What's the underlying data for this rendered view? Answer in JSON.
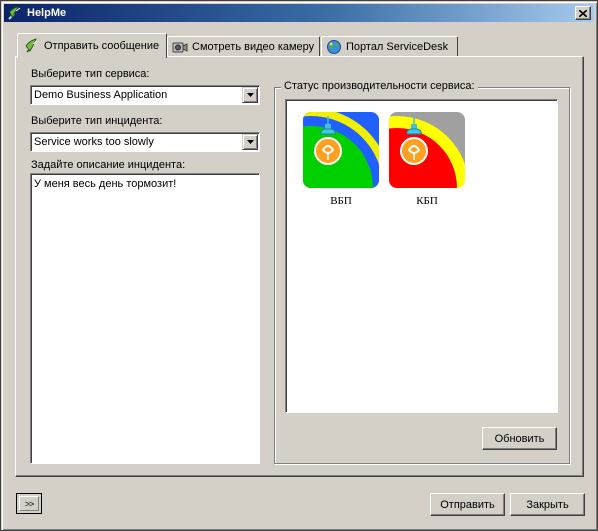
{
  "window": {
    "title": "HelpMe",
    "close_label": "X",
    "title_gradient": [
      "#0a246a",
      "#a6caf0"
    ]
  },
  "tabs": [
    {
      "label": "Отправить сообщение",
      "icon": "satellite-dish-icon",
      "active": true
    },
    {
      "label": "Смотреть видео камеру",
      "icon": "camera-icon",
      "active": false
    },
    {
      "label": "Портал ServiceDesk",
      "icon": "globe-icon",
      "active": false
    }
  ],
  "form": {
    "service_type_label": "Выберите тип сервиса:",
    "service_type_value": "Demo Business Application",
    "incident_type_label": "Выберите тип инцидента:",
    "incident_type_value": "Service works too slowly",
    "description_label": "Задайте описание инцидента:",
    "description_value": "У меня весь день тормозит!"
  },
  "status": {
    "title": "Статус производительности сервиса:",
    "indicators": [
      {
        "label": "ВБП",
        "icon": "lightbulb-icon",
        "colors": [
          "#00d000",
          "#2060ff",
          "#f0f000"
        ]
      },
      {
        "label": "КБП",
        "icon": "lightbulb-icon",
        "colors": [
          "#ff0000",
          "#ffff00",
          "#a0a0a0"
        ]
      }
    ],
    "refresh_label": "Обновить"
  },
  "footer": {
    "expand_label": ">>",
    "send_label": "Отправить",
    "close_label": "Закрыть"
  }
}
